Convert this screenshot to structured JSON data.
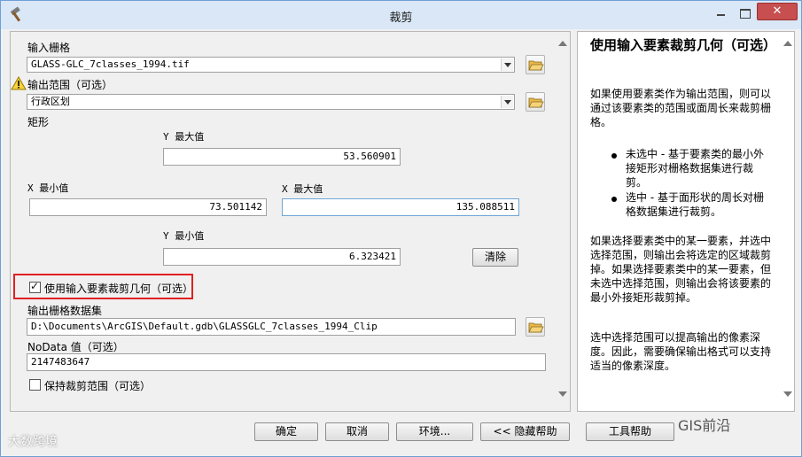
{
  "window": {
    "title": "裁剪"
  },
  "form": {
    "input_raster_label": "输入栅格",
    "input_raster_value": "GLASS-GLC_7classes_1994.tif",
    "output_extent_label": "输出范围（可选）",
    "output_extent_value": "行政区划",
    "rectangle_label": "矩形",
    "y_max_label": "Y 最大值",
    "y_max_value": "53.560901",
    "x_min_label": "X 最小值",
    "x_min_value": "73.501142",
    "x_max_label": "X 最大值",
    "x_max_value": "135.088511",
    "y_min_label": "Y 最小值",
    "y_min_value": "6.323421",
    "clear_button": "清除",
    "use_geometry_label": "使用输入要素裁剪几何（可选）",
    "use_geometry_checked": true,
    "output_dataset_label": "输出栅格数据集",
    "output_dataset_value": "D:\\Documents\\ArcGIS\\Default.gdb\\GLASSGLC_7classes_1994_Clip",
    "nodata_label": "NoData 值（可选）",
    "nodata_value": "2147483647",
    "keep_extent_label": "保持裁剪范围（可选）",
    "keep_extent_checked": false
  },
  "help": {
    "title": "使用输入要素裁剪几何（可选）",
    "para1": "如果使用要素类作为输出范围，则可以通过该要素类的范围或面周长来裁剪栅格。",
    "bullet1": "未选中 - 基于要素类的最小外接矩形对栅格数据集进行裁剪。",
    "bullet2": "选中 - 基于面形状的周长对栅格数据集进行裁剪。",
    "para2": "如果选择要素类中的某一要素，并选中选择范围，则输出会将选定的区域裁剪掉。如果选择要素类中的某一要素，但未选中选择范围，则输出会将该要素的最小外接矩形裁剪掉。",
    "para3": "选中选择范围可以提高输出的像素深度。因此，需要确保输出格式可以支持适当的像素深度。"
  },
  "footer": {
    "ok": "确定",
    "cancel": "取消",
    "environments": "环境...",
    "hide_help": "<< 隐藏帮助",
    "tool_help": "工具帮助"
  },
  "watermarks": {
    "left": "大数跨境",
    "right": "GIS前沿"
  }
}
